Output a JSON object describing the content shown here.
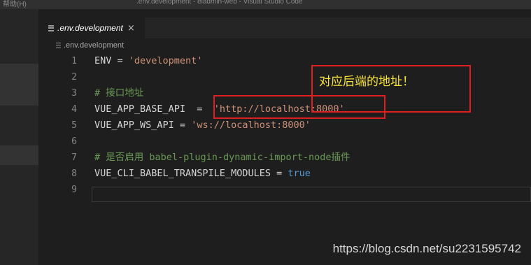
{
  "titlebar": {
    "menu_text": "帮助(H)",
    "window_title": ".env.development - eladmin-web - Visual Studio Code"
  },
  "tab": {
    "label": ".env.development",
    "close_glyph": "×"
  },
  "breadcrumb": {
    "label": ".env.development"
  },
  "code": {
    "lines": [
      {
        "number": "1",
        "tokens": [
          {
            "t": "ENV",
            "k": "key"
          },
          {
            "t": " = ",
            "k": "op"
          },
          {
            "t": "'development'",
            "k": "str"
          }
        ]
      },
      {
        "number": "2",
        "tokens": []
      },
      {
        "number": "3",
        "tokens": [
          {
            "t": "# 接口地址",
            "k": "com"
          }
        ]
      },
      {
        "number": "4",
        "tokens": [
          {
            "t": "VUE_APP_BASE_API",
            "k": "key"
          },
          {
            "t": "  =  ",
            "k": "op"
          },
          {
            "t": "'http://localhost:8000'",
            "k": "str"
          }
        ]
      },
      {
        "number": "5",
        "tokens": [
          {
            "t": "VUE_APP_WS_API",
            "k": "key"
          },
          {
            "t": " = ",
            "k": "op"
          },
          {
            "t": "'ws://localhost:8000'",
            "k": "str"
          }
        ]
      },
      {
        "number": "6",
        "tokens": []
      },
      {
        "number": "7",
        "tokens": [
          {
            "t": "# 是否启用 babel-plugin-dynamic-import-node插件",
            "k": "com"
          }
        ]
      },
      {
        "number": "8",
        "tokens": [
          {
            "t": "VUE_CLI_BABEL_TRANSPILE_MODULES",
            "k": "key"
          },
          {
            "t": " = ",
            "k": "op"
          },
          {
            "t": "true",
            "k": "bool"
          }
        ]
      },
      {
        "number": "9",
        "tokens": []
      }
    ]
  },
  "annotation": {
    "text": "对应后端的地址！",
    "color": "#f5e13a",
    "box_color": "#e02020"
  },
  "watermark": {
    "text": "https://blog.csdn.net/su2231595742"
  },
  "colors": {
    "editor_bg": "#1e1e1e",
    "string": "#ce9178",
    "comment": "#6a9955",
    "keyword": "#569cd6",
    "line_number": "#858585"
  }
}
